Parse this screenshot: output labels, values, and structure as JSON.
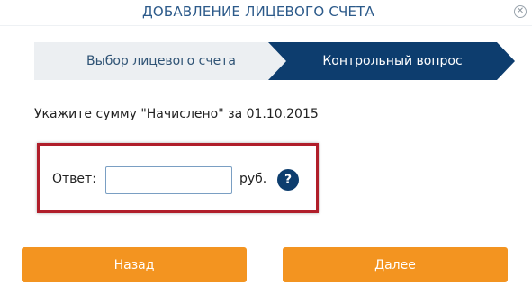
{
  "dialog": {
    "title": "ДОБАВЛЕНИЕ ЛИЦЕВОГО СЧЕТА",
    "close_icon": "close-circle-icon",
    "close_glyph": "✕"
  },
  "steps": [
    {
      "label": "Выбор лицевого счета",
      "active": false
    },
    {
      "label": "Контрольный вопрос",
      "active": true
    }
  ],
  "colors": {
    "title": "#2c5a8a",
    "step_inactive_bg": "#eceff2",
    "step_active_bg": "#0d3d6e",
    "highlight_border": "#b01e2a",
    "button_bg": "#f39420"
  },
  "question": {
    "text": "Укажите сумму \"Начислено\" за 01.10.2015"
  },
  "answer": {
    "label": "Ответ:",
    "value": "",
    "placeholder": "",
    "unit": "руб.",
    "help_glyph": "?",
    "help_icon": "help-question-icon"
  },
  "buttons": {
    "back": "Назад",
    "next": "Далее"
  }
}
